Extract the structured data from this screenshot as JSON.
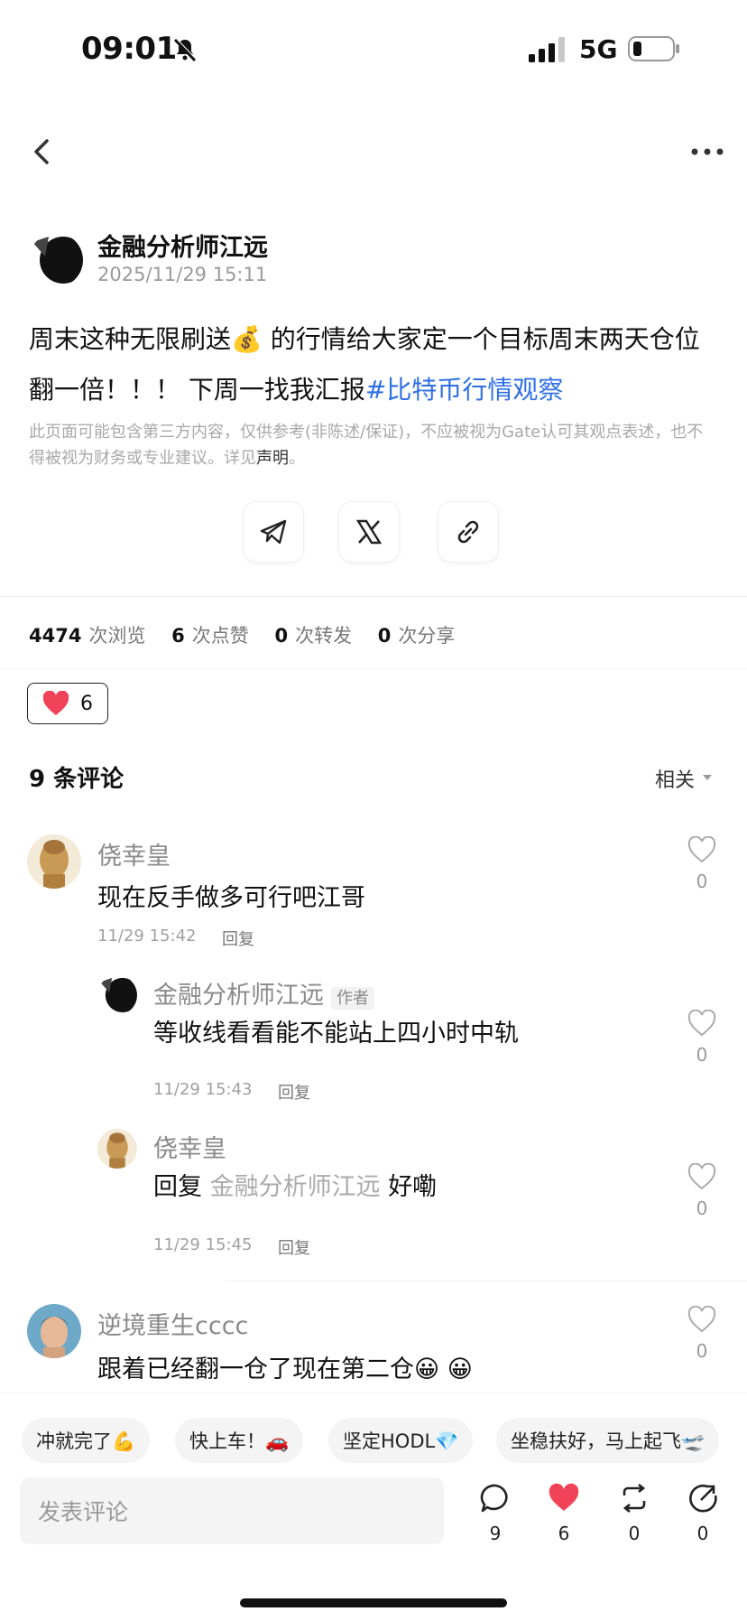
{
  "status_bar": {
    "time": "09:01",
    "network": "5G"
  },
  "post": {
    "author": "金融分析师江远",
    "time": "2025/11/29 15:11",
    "body_part1": "周末这种无限刷送💰 的行情给大家定一个目标周末两天仓位翻一倍！！！ 下周一找我汇报",
    "hashtag": "#比特币行情观察",
    "disclaimer": "此页面可能包含第三方内容，仅供参考(非陈述/保证)，不应被视为Gate认可其观点表述，也不得被视为财务或专业建议。详见",
    "disclaimer_link": "声明",
    "disclaimer_end": "。"
  },
  "stats": {
    "views": "4474",
    "views_label": "次浏览",
    "likes": "6",
    "likes_label": "次点赞",
    "reposts": "0",
    "reposts_label": "次转发",
    "shares": "0",
    "shares_label": "次分享"
  },
  "like_button": {
    "count": "6"
  },
  "comments_header": {
    "title": "9 条评论",
    "sort": "相关"
  },
  "comments": [
    {
      "name": "侥幸皇",
      "text": "现在反手做多可行吧江哥",
      "time": "11/29 15:42",
      "reply": "回复",
      "likes": "0"
    },
    {
      "name": "金融分析师江远",
      "tag": "作者",
      "text": "等收线看看能不能站上四小时中轨",
      "time": "11/29 15:43",
      "reply": "回复",
      "likes": "0"
    },
    {
      "name": "侥幸皇",
      "reply_prefix": "回复",
      "mention": "金融分析师江远",
      "text": "好嘞",
      "time": "11/29 15:45",
      "reply": "回复",
      "likes": "0"
    },
    {
      "name": "逆境重生cccc",
      "text": "跟着已经翻一仓了现在第二仓😀 😀",
      "likes": "0"
    }
  ],
  "quick_replies": [
    "冲就完了💪",
    "快上车！🚗",
    "坚定HODL💎",
    "坐稳扶好，马上起飞🛫"
  ],
  "bottom_bar": {
    "input_placeholder": "发表评论",
    "comment_count": "9",
    "like_count": "6",
    "repost_count": "0",
    "share_count": "0"
  },
  "colors": {
    "accent_link": "#2f6fe4",
    "heart": "#f0435a"
  }
}
